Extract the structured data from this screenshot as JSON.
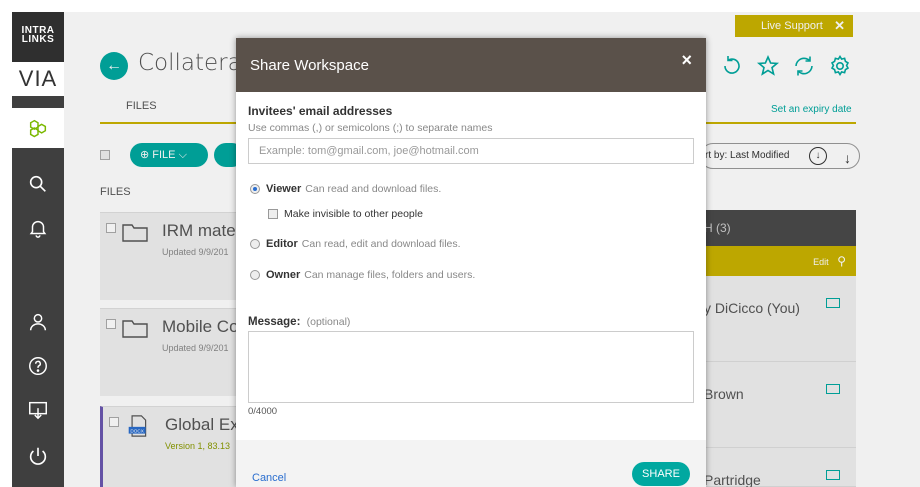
{
  "app": {
    "logo_top": "INTRA LINKS",
    "logo_brand": "VIA"
  },
  "rail": {
    "items": [
      "hexagons-icon",
      "search-icon",
      "bell-icon",
      "user-icon",
      "help-icon",
      "download-icon",
      "power-icon"
    ]
  },
  "live_support": {
    "label": "Live Support",
    "close": "✕"
  },
  "workspace": {
    "title": "Collateral",
    "tab_files": "FILES",
    "expiry_link": "Set an expiry date",
    "file_button": "FILE",
    "sort_label": "rt by: Last Modified",
    "files_label": "FILES"
  },
  "files": [
    {
      "name": "IRM mate",
      "meta": "Updated 9/9/201"
    },
    {
      "name": "Mobile Co",
      "meta": "Updated 9/9/201"
    },
    {
      "name": "Global Ex",
      "meta": "Version 1, 83.13",
      "badge": "DOCX"
    }
  ],
  "people": {
    "header": "H (3)",
    "edit_label": "Edit",
    "list": [
      {
        "name": "y DiCicco (You)"
      },
      {
        "name": "Brown"
      },
      {
        "name": "Partridge"
      }
    ]
  },
  "modal": {
    "title": "Share Workspace",
    "close": "×",
    "emails_label": "Invitees' email addresses",
    "emails_hint": "Use commas (,) or semicolons (;) to separate names",
    "emails_placeholder": "Example: tom@gmail.com, joe@hotmail.com",
    "roles": [
      {
        "name": "Viewer",
        "desc": "Can read and download files.",
        "selected": true
      },
      {
        "name": "Editor",
        "desc": "Can read, edit and download files.",
        "selected": false
      },
      {
        "name": "Owner",
        "desc": "Can manage files, folders and users.",
        "selected": false
      }
    ],
    "invisible_label": "Make invisible to other people",
    "message_label": "Message:",
    "message_optional": "(optional)",
    "counter": "0/4000",
    "cancel": "Cancel",
    "share": "SHARE"
  },
  "colors": {
    "teal": "#00a8a0",
    "gold": "#c9b200",
    "rail": "#3f3f3f",
    "modal_header": "#5a514a"
  }
}
